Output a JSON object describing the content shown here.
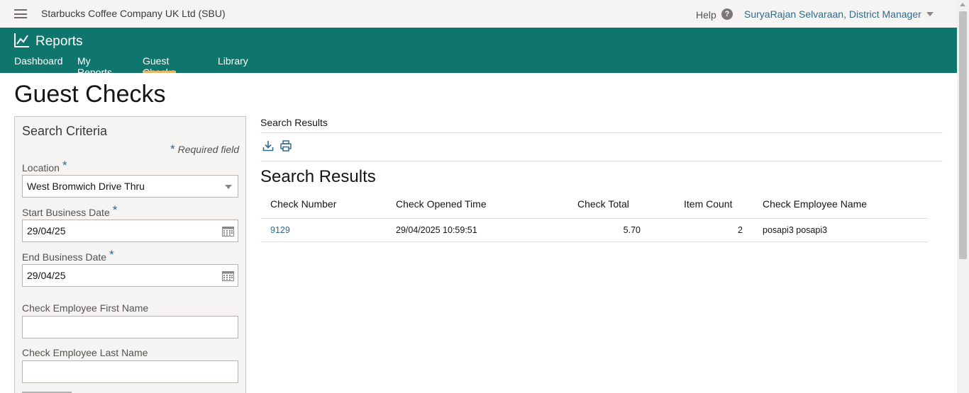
{
  "topbar": {
    "company": "Starbucks Coffee Company UK Ltd (SBU)",
    "help_label": "Help",
    "help_icon": "question-circle-icon",
    "user": "SuryaRajan Selvaraan, District Manager"
  },
  "appbar": {
    "title": "Reports",
    "icon": "line-chart-icon",
    "nav": [
      {
        "label": "Dashboard"
      },
      {
        "label": "My Reports"
      },
      {
        "label": "Guest Checks",
        "active": true
      },
      {
        "label": "Library"
      }
    ],
    "colors": {
      "background": "#0f766e",
      "active_underline": "#e3b86a"
    }
  },
  "page": {
    "title": "Guest Checks"
  },
  "criteria": {
    "title": "Search Criteria",
    "required_star": "*",
    "required_note": "Required field",
    "location_label": "Location",
    "location_value": "West Bromwich Drive Thru",
    "start_label": "Start Business Date",
    "start_value": "29/04/25",
    "end_label": "End Business Date",
    "end_value": "29/04/25",
    "first_name_label": "Check Employee First Name",
    "first_name_value": "",
    "last_name_label": "Check Employee Last Name",
    "last_name_value": ""
  },
  "results": {
    "crumb": "Search Results",
    "title": "Search Results",
    "toolbar": [
      "download-icon",
      "print-icon"
    ],
    "columns": [
      "Check Number",
      "Check Opened Time",
      "Check Total",
      "Item Count",
      "Check Employee Name"
    ],
    "rows": [
      {
        "check_number": "9129",
        "opened_time": "29/04/2025 10:59:51",
        "total": "5.70",
        "item_count": "2",
        "employee": "posapi3 posapi3"
      }
    ]
  }
}
